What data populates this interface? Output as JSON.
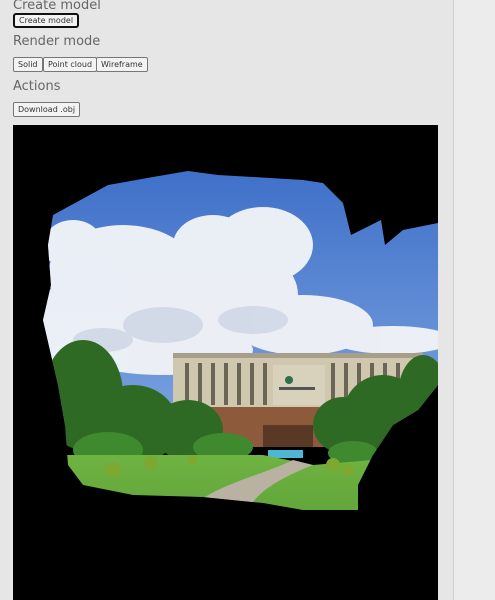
{
  "sections": {
    "create": {
      "heading": "Create model",
      "button": "Create model"
    },
    "render": {
      "heading": "Render mode",
      "buttons": [
        "Solid",
        "Point cloud",
        "Wireframe"
      ]
    },
    "actions": {
      "heading": "Actions",
      "button": "Download .obj"
    }
  },
  "colors": {
    "background": "#e6e6e6",
    "viewport_bg": "#000000",
    "sky": "#4b78c9",
    "cloud": "#f2f4f8",
    "grass": "#5fa43a",
    "building": "#c9c0a8"
  },
  "viewport": {
    "content": "3D mesh rendering of a building with clouds and lawn"
  }
}
